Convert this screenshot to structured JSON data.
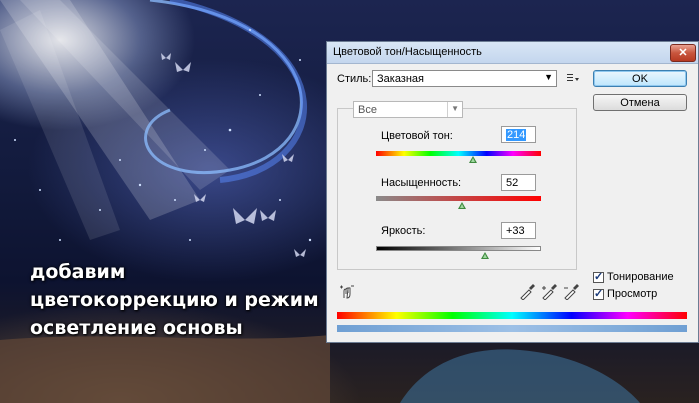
{
  "caption": {
    "lines": [
      "добавим",
      "цветокоррекцию и режим",
      "осветление основы"
    ]
  },
  "dialog": {
    "title": "Цветовой тон/Насыщенность",
    "close_symbol": "✕",
    "preset_label": "Стиль:",
    "preset_value": "Заказная",
    "channel_value": "Все",
    "hue_label": "Цветовой тон:",
    "hue_value": "214",
    "saturation_label": "Насыщенность:",
    "saturation_value": "52",
    "lightness_label": "Яркость:",
    "lightness_value": "+33",
    "ok_label": "OK",
    "cancel_label": "Отмена",
    "colorize_label": "Тонирование",
    "colorize_checked": true,
    "preview_label": "Просмотр",
    "preview_checked": true,
    "slider_levels": {
      "hue": 0.6,
      "saturation": 0.52,
      "lightness": 0.67
    },
    "icons": [
      "preset-options-icon",
      "on-image-adjust-icon",
      "eyedropper-icon",
      "eyedropper-plus-icon",
      "eyedropper-minus-icon",
      "chevron-down-icon"
    ],
    "accent": "#3399ff"
  }
}
